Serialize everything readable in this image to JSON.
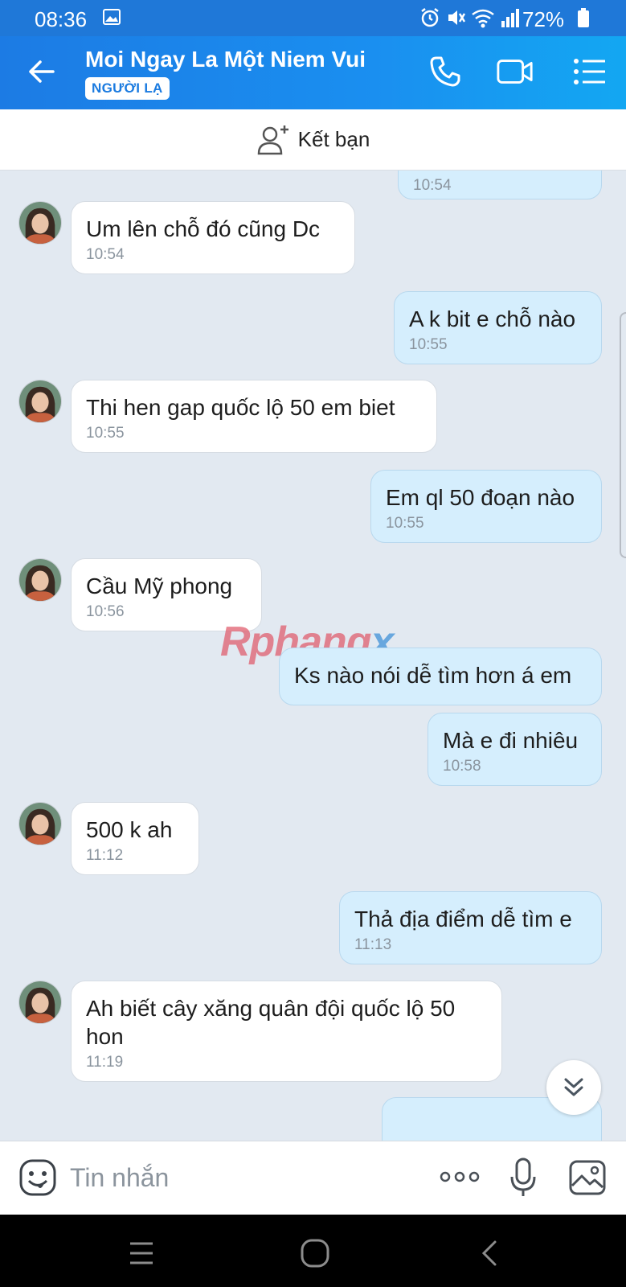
{
  "status": {
    "time": "08:36",
    "battery": "72%"
  },
  "header": {
    "title": "Moi Ngay La Một Niem Vui",
    "badge": "NGƯỜI LẠ"
  },
  "friend_bar": {
    "label": "Kết bạn"
  },
  "chat": {
    "partial_top_time": "10:54",
    "messages": [
      {
        "side": "in",
        "text": "Um lên chỗ đó cũng Dc",
        "time": "10:54"
      },
      {
        "side": "out",
        "text": "A k bit e chỗ nào",
        "time": "10:55"
      },
      {
        "side": "in",
        "text": "Thi hen gap quốc lộ 50 em biet",
        "time": "10:55"
      },
      {
        "side": "out",
        "text": "Em ql 50 đoạn nào",
        "time": "10:55"
      },
      {
        "side": "in",
        "text": "Cầu Mỹ phong",
        "time": "10:56"
      },
      {
        "side": "out",
        "text": "Ks nào nói dễ tìm hơn á em",
        "time": ""
      },
      {
        "side": "out",
        "text": "Mà e đi nhiêu",
        "time": "10:58"
      },
      {
        "side": "in",
        "text": "500 k ah",
        "time": "11:12"
      },
      {
        "side": "out",
        "text": "Thả địa điểm dễ tìm e",
        "time": "11:13"
      },
      {
        "side": "in",
        "text": "Ah biết cây xăng quân đội quốc lộ 50 hon",
        "time": "11:19"
      }
    ],
    "watermark": {
      "main": "Rphang",
      "accent": "x"
    }
  },
  "composer": {
    "placeholder": "Tin nhắn"
  },
  "colors": {
    "brand": "#1c7be4",
    "outgoing_bubble": "#d5eefd",
    "incoming_bubble": "#ffffff",
    "background": "#e2e9f1"
  },
  "icons": [
    "back-arrow-icon",
    "phone-icon",
    "video-call-icon",
    "menu-list-icon",
    "add-friend-icon",
    "emoji-icon",
    "more-icon",
    "microphone-icon",
    "image-icon",
    "double-chevron-down-icon"
  ]
}
